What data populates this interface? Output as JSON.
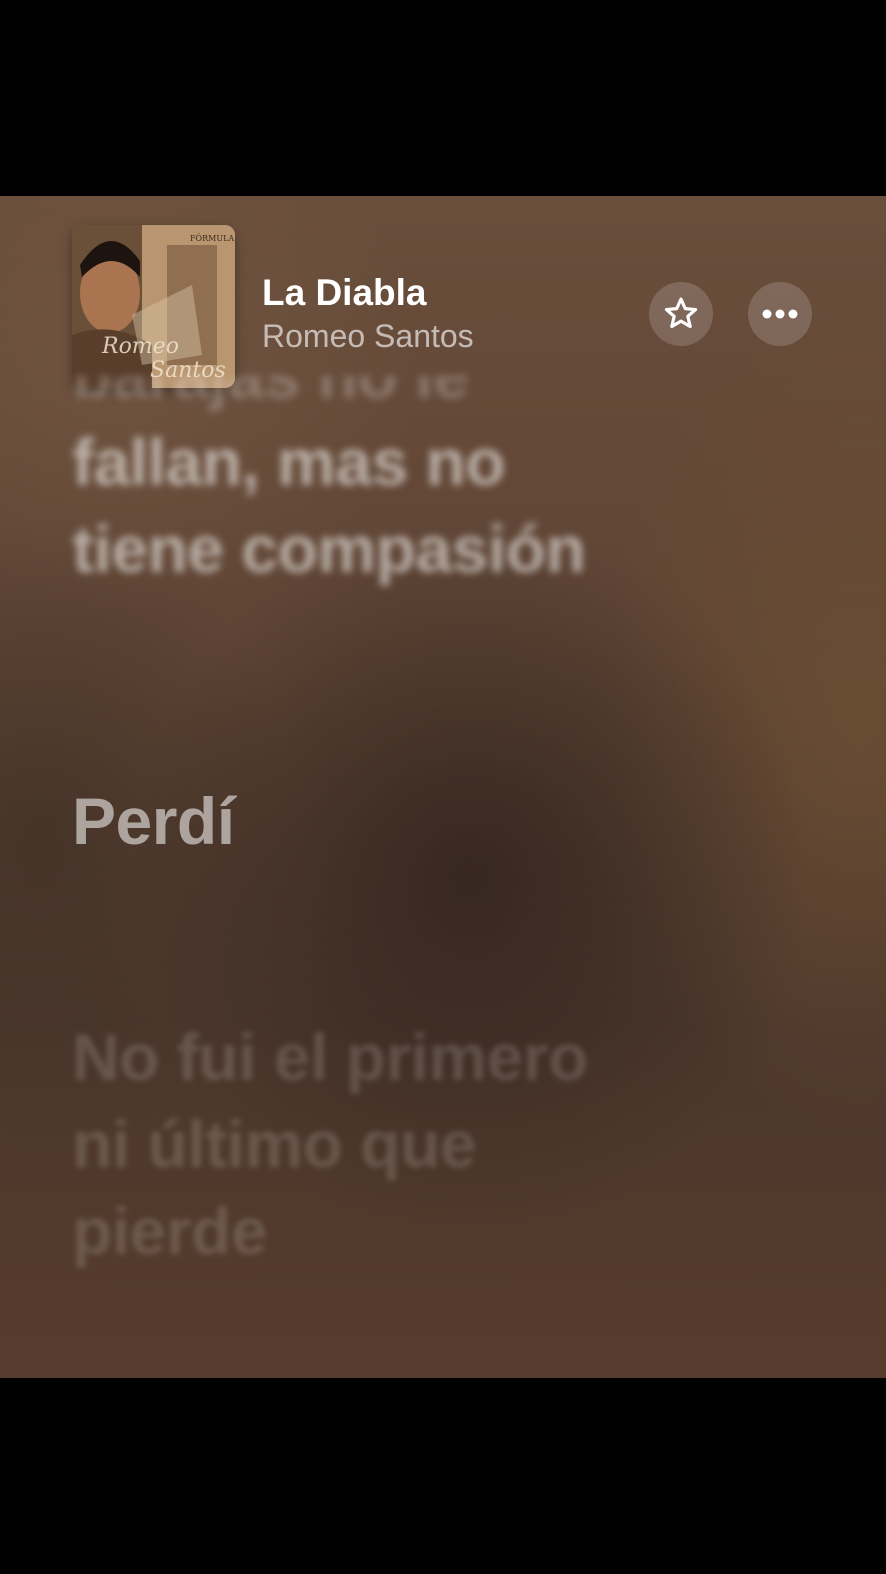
{
  "track": {
    "title": "La Diabla",
    "artist": "Romeo Santos"
  },
  "album_cover": {
    "badge": "FÓRMULA",
    "script_line1": "Romeo",
    "script_line2": "Santos"
  },
  "actions": {
    "favorite_icon": "star-icon",
    "more_icon": "ellipsis-icon"
  },
  "lyrics": {
    "previous": [
      "barajas no le",
      "fallan, mas no",
      "tiene compasión"
    ],
    "current": "Perdí",
    "next": [
      "No fui el primero",
      "ni último que",
      "pierde"
    ]
  }
}
